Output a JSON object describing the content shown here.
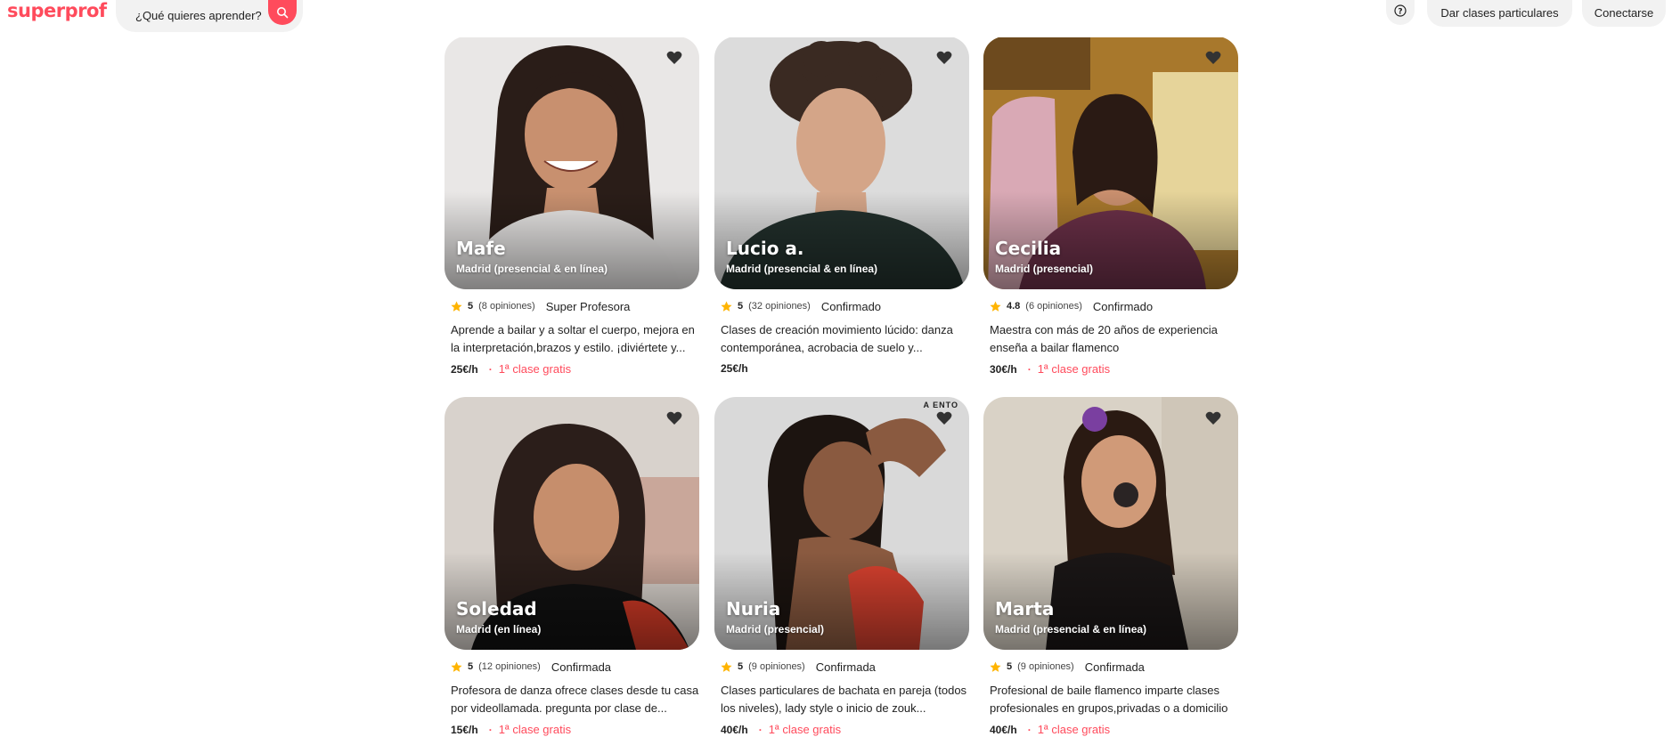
{
  "header": {
    "logo": "superprof",
    "search_placeholder": "¿Qué quieres aprender?",
    "give_classes": "Dar clases particulares",
    "login": "Conectarse"
  },
  "accent": "#ff4b5c",
  "cards": [
    {
      "name": "Mafe",
      "location": "Madrid (presencial & en línea)",
      "rating": "5",
      "opinions": "(8 opiniones)",
      "status": "Super Profesora",
      "description": "Aprende a bailar y a soltar el cuerpo, mejora en la interpretación,brazos y estilo. ¡diviértete y...",
      "price": "25€/h",
      "free": "1ª clase gratis",
      "tag": ""
    },
    {
      "name": "Lucio a.",
      "location": "Madrid (presencial & en línea)",
      "rating": "5",
      "opinions": "(32 opiniones)",
      "status": "Confirmado",
      "description": "Clases de creación movimiento lúcido: danza contemporánea, acrobacia de suelo y...",
      "price": "25€/h",
      "free": "",
      "tag": ""
    },
    {
      "name": "Cecilia",
      "location": "Madrid (presencial)",
      "rating": "4.8",
      "opinions": "(6 opiniones)",
      "status": "Confirmado",
      "description": "Maestra con más de 20 años de experiencia enseña a bailar flamenco",
      "price": "30€/h",
      "free": "1ª clase gratis",
      "tag": ""
    },
    {
      "name": "Soledad",
      "location": "Madrid (en línea)",
      "rating": "5",
      "opinions": "(12 opiniones)",
      "status": "Confirmada",
      "description": "Profesora de danza ofrece clases desde tu casa por videollamada. pregunta por clase de...",
      "price": "15€/h",
      "free": "1ª clase gratis",
      "tag": ""
    },
    {
      "name": "Nuria",
      "location": "Madrid (presencial)",
      "rating": "5",
      "opinions": "(9 opiniones)",
      "status": "Confirmada",
      "description": "Clases particulares de bachata en pareja (todos los niveles), lady style o inicio de zouk...",
      "price": "40€/h",
      "free": "1ª clase gratis",
      "tag": "A ENTO"
    },
    {
      "name": "Marta",
      "location": "Madrid (presencial & en línea)",
      "rating": "5",
      "opinions": "(9 opiniones)",
      "status": "Confirmada",
      "description": "Profesional de baile flamenco imparte clases profesionales en grupos,privadas o a domicilio",
      "price": "40€/h",
      "free": "1ª clase gratis",
      "tag": ""
    }
  ]
}
